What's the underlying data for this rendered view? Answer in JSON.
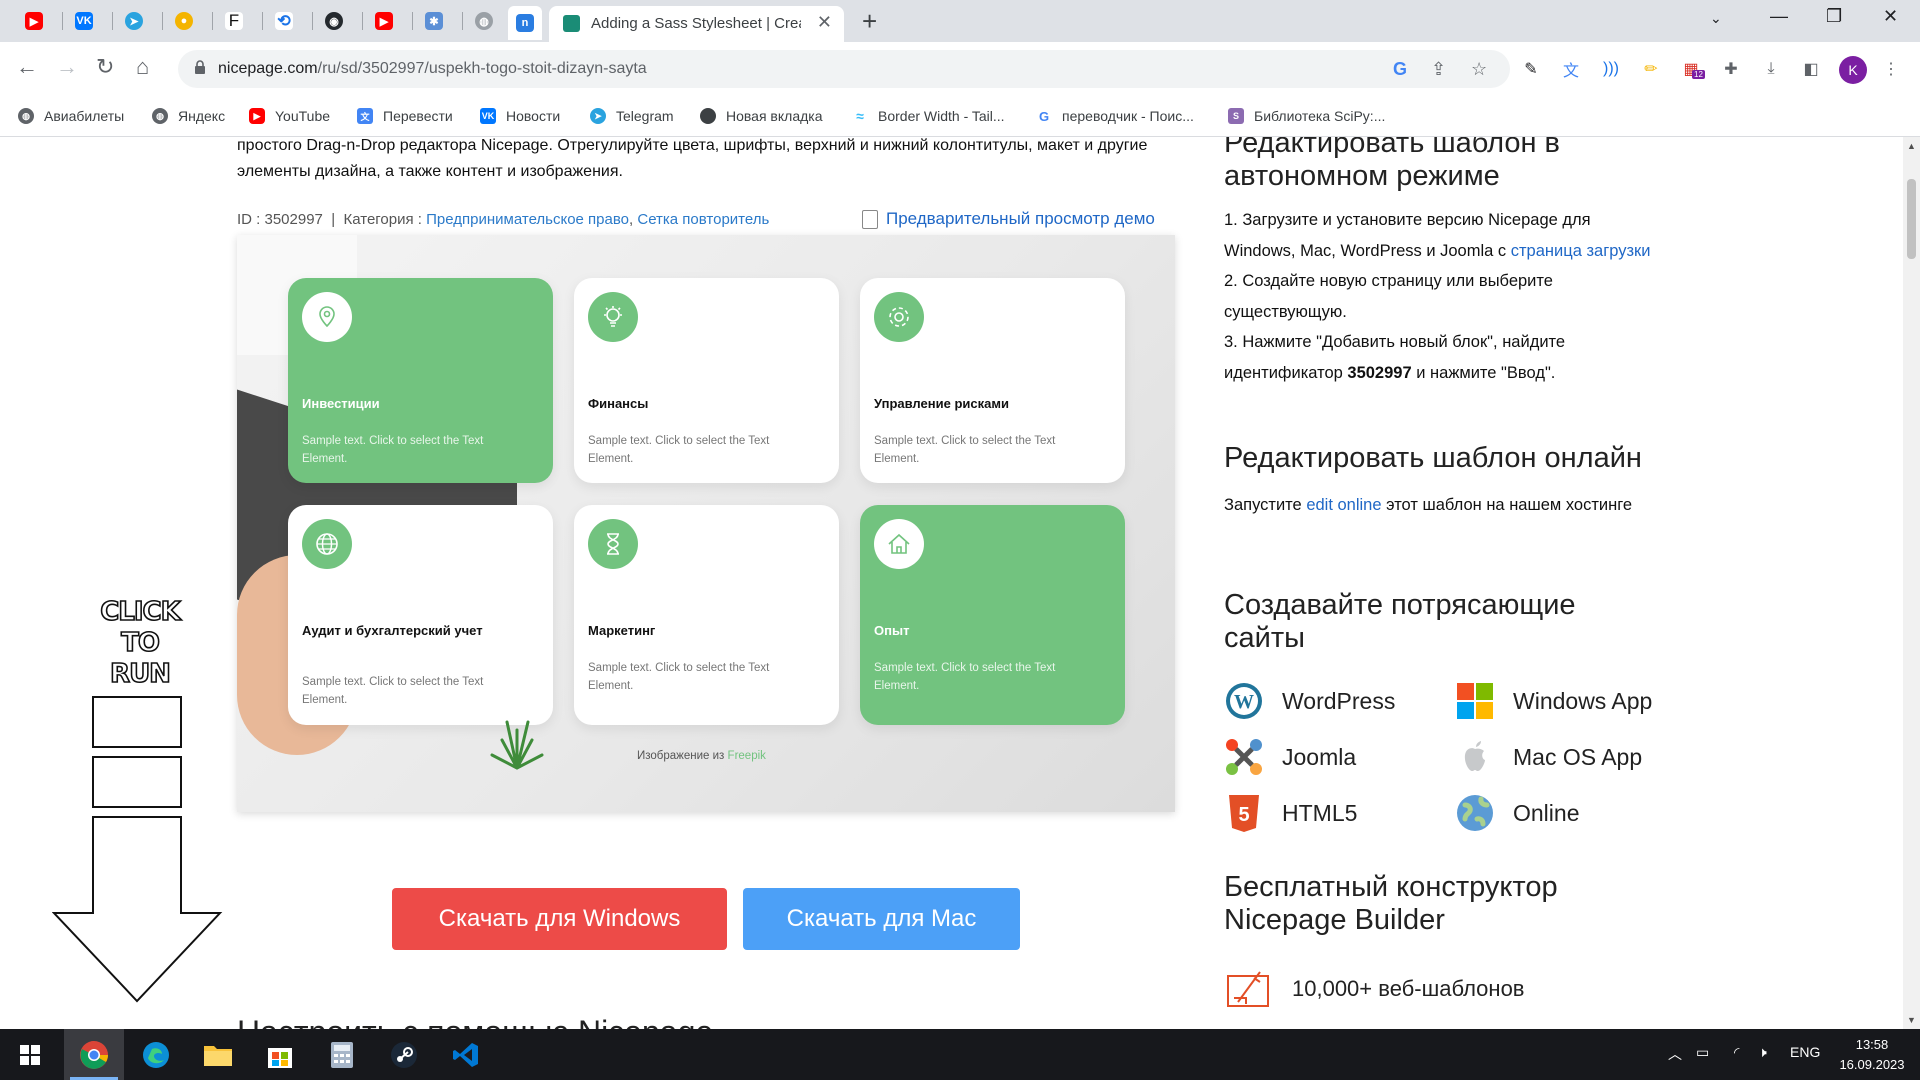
{
  "browser": {
    "active_tab": {
      "title": "Adding a Sass Stylesheet | Create"
    },
    "url": {
      "host": "nicepage.com",
      "path": "/ru/sd/3502997/uspekh-togo-stoit-dizayn-sayta"
    },
    "avatar_letter": "K",
    "extension_badge": "12",
    "bookmarks": [
      "Авиабилеты",
      "Яндекс",
      "YouTube",
      "Перевести",
      "Новости",
      "Telegram",
      "Новая вкладка",
      "Border Width - Tail...",
      "переводчик - Поис...",
      "Библиотека SciPy:..."
    ]
  },
  "page": {
    "description": "простого Drag-n-Drop редактора Nicepage. Отрегулируйте цвета, шрифты, верхний и нижний колонтитулы, макет и другие элементы дизайна, а также контент и изображения.",
    "meta": {
      "id_label": "ID : 3502997",
      "separator": "|",
      "category_label": "Категория :",
      "category_1": "Предпринимательское право",
      "comma": ",",
      "category_2": "Сетка повторитель"
    },
    "preview_link": "Предварительный просмотр демо",
    "template_cards": [
      {
        "title": "Инвестиции",
        "text": "Sample text. Click to select the Text Element.",
        "icon": "location-pin-icon"
      },
      {
        "title": "Финансы",
        "text": "Sample text. Click to select the Text Element.",
        "icon": "lightbulb-icon"
      },
      {
        "title": "Управление рисками",
        "text": "Sample text. Click to select the Text Element.",
        "icon": "gear-icon"
      },
      {
        "title": "Аудит и бухгалтерский учет",
        "text": "Sample text. Click to select the Text Element.",
        "icon": "globe-icon"
      },
      {
        "title": "Маркетинг",
        "text": "Sample text. Click to select the Text Element.",
        "icon": "hourglass-icon"
      },
      {
        "title": "Опыт",
        "text": "Sample text. Click to select the Text Element.",
        "icon": "house-icon"
      }
    ],
    "image_credit": {
      "prefix": "Изображение из",
      "source": "Freepik"
    },
    "download_windows": "Скачать для Windows",
    "download_mac": "Скачать для Mac",
    "cut_heading": "Настроить с помощью Nicepage",
    "click_to_run": [
      "CLICK",
      "TO",
      "RUN"
    ]
  },
  "sidebar": {
    "offline_heading": "Редактировать шаблон в автономном режиме",
    "offline_steps": {
      "s1_prefix": "1. Загрузите и установите версию Nicepage для Windows, Mac, WordPress и Joomla с ",
      "s1_link": "страница загрузки",
      "s2": "2. Создайте новую страницу или выберите существующую.",
      "s3_prefix": "3. Нажмите \"Добавить новый блок\", найдите идентификатор ",
      "s3_id": "3502997",
      "s3_suffix": " и нажмите \"Ввод\"."
    },
    "online_heading": "Редактировать шаблон онлайн",
    "online_text": {
      "prefix": "Запустите ",
      "link": "edit online",
      "suffix": " этот шаблон на нашем хостинге"
    },
    "create_heading": "Создавайте потрясающие сайты",
    "platforms": [
      "WordPress",
      "Windows App",
      "Joomla",
      "Mac OS App",
      "HTML5",
      "Online"
    ],
    "builder_heading": "Бесплатный конструктор Nicepage Builder",
    "feature_1": "10,000+ веб-шаблонов"
  },
  "taskbar": {
    "language": "ENG",
    "time": "13:58",
    "date": "16.09.2023"
  },
  "colors": {
    "accent_green": "#72c37f",
    "download_windows": "#ed4b48",
    "download_mac": "#4ca0f7",
    "link_blue": "#1f67c6"
  }
}
